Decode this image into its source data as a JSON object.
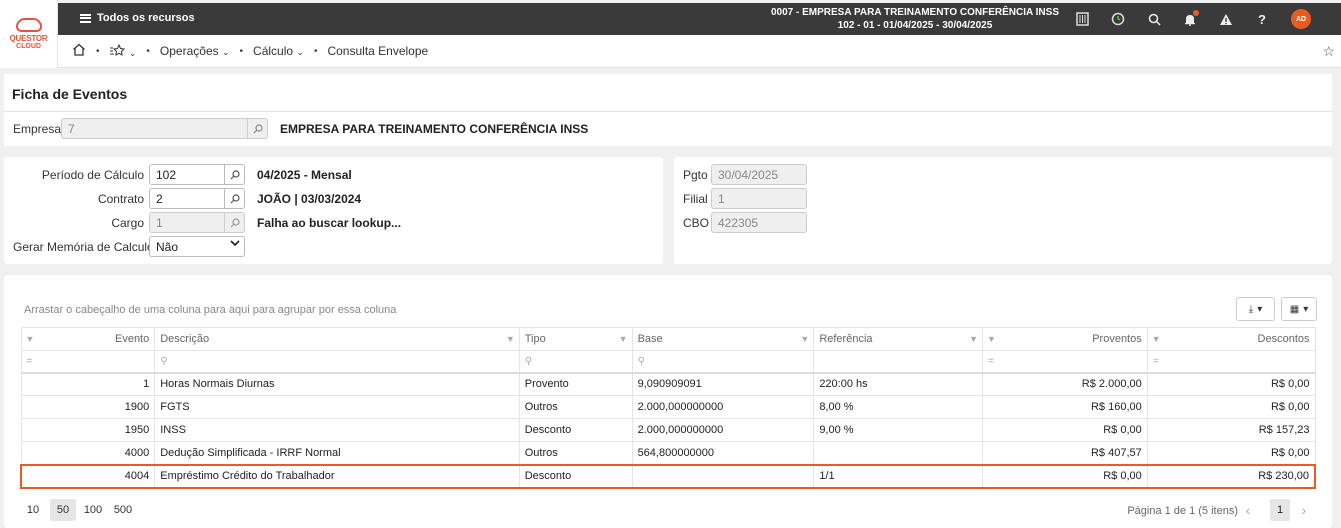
{
  "logo": {
    "line1": "QUESTOR",
    "line2": "CLOUD"
  },
  "topbar": {
    "menu_label": "Todos os recursos",
    "company_line1": "0007 - EMPRESA PARA TREINAMENTO CONFERÊNCIA INSS",
    "company_line2": "102 - 01 - 01/04/2025 - 30/04/2025",
    "avatar": "AD"
  },
  "breadcrumb": {
    "operacoes": "Operações",
    "calculo": "Cálculo",
    "current": "Consulta Envelope"
  },
  "page": {
    "title": "Ficha de Eventos"
  },
  "empresa": {
    "label": "Empresa",
    "value": "7",
    "name": "EMPRESA PARA TREINAMENTO CONFERÊNCIA INSS"
  },
  "form": {
    "periodo_label": "Período de Cálculo",
    "periodo_value": "102",
    "periodo_desc": "04/2025 - Mensal",
    "contrato_label": "Contrato",
    "contrato_value": "2",
    "contrato_desc": "JOÃO | 03/03/2024",
    "cargo_label": "Cargo",
    "cargo_value": "1",
    "cargo_desc": "Falha ao buscar lookup...",
    "memoria_label": "Gerar Memória de Calculo ?",
    "memoria_value": "Não",
    "pgto_label": "Pgto",
    "pgto_value": "30/04/2025",
    "filial_label": "Filial",
    "filial_value": "1",
    "cbo_label": "CBO",
    "cbo_value": "422305"
  },
  "grid": {
    "group_hint": "Arrastar o cabeçalho de uma coluna para aqui para agrupar por essa coluna",
    "columns": [
      "Evento",
      "Descrição",
      "Tipo",
      "Base",
      "Referência",
      "Proventos",
      "Descontos"
    ],
    "rows": [
      {
        "evento": "1",
        "descricao": "Horas Normais Diurnas",
        "tipo": "Provento",
        "base": "9,090909091",
        "referencia": "220:00 hs",
        "proventos": "R$ 2.000,00",
        "descontos": "R$ 0,00"
      },
      {
        "evento": "1900",
        "descricao": "FGTS",
        "tipo": "Outros",
        "base": "2.000,000000000",
        "referencia": "8,00 %",
        "proventos": "R$ 160,00",
        "descontos": "R$ 0,00"
      },
      {
        "evento": "1950",
        "descricao": "INSS",
        "tipo": "Desconto",
        "base": "2.000,000000000",
        "referencia": "9,00 %",
        "proventos": "R$ 0,00",
        "descontos": "R$ 157,23"
      },
      {
        "evento": "4000",
        "descricao": "Dedução Simplificada - IRRF Normal",
        "tipo": "Outros",
        "base": "564,800000000",
        "referencia": "",
        "proventos": "R$ 407,57",
        "descontos": "R$ 0,00"
      },
      {
        "evento": "4004",
        "descricao": "Empréstimo Crédito do Trabalhador",
        "tipo": "Desconto",
        "base": "",
        "referencia": "1/1",
        "proventos": "R$ 0,00",
        "descontos": "R$ 230,00"
      }
    ],
    "page_sizes": [
      "10",
      "50",
      "100",
      "500"
    ],
    "page_info": "Página 1 de 1 (5 itens)",
    "current_page": "1"
  },
  "colors": {
    "accent": "#e85c22",
    "topbar": "#3a3a3a"
  }
}
